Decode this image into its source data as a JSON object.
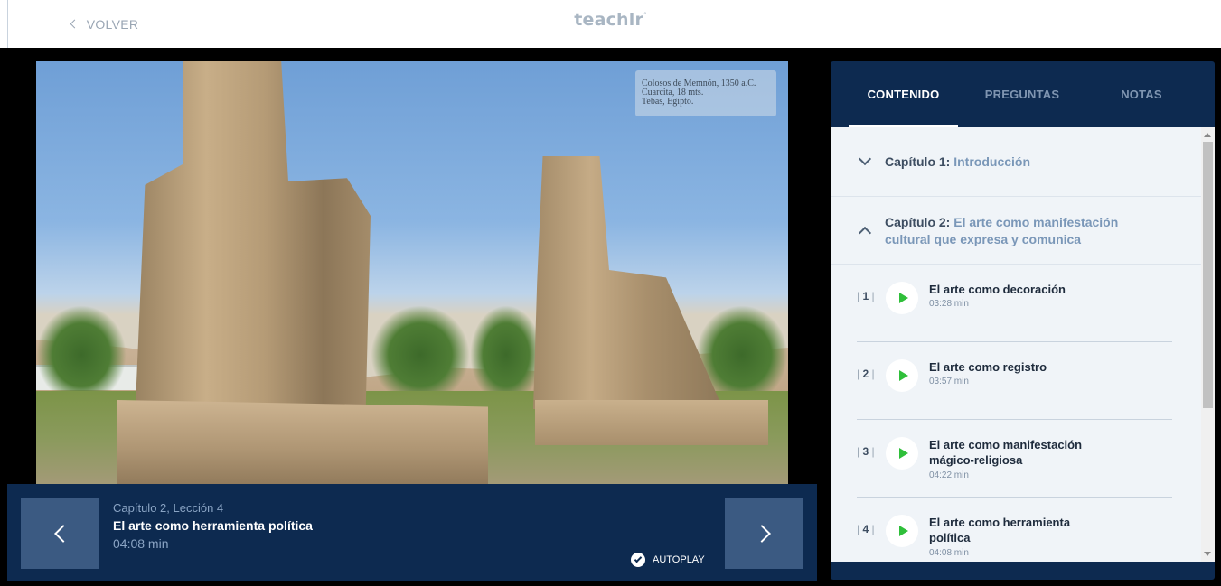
{
  "header": {
    "back_label": "VOLVER",
    "logo": "teachlr",
    "logo_mark": "°"
  },
  "video": {
    "caption": [
      "Colosos de Memnón, 1350 a.C.",
      "Cuarcita, 18 mts.",
      "Tebas, Egipto."
    ]
  },
  "current_lesson": {
    "chapter_label": "Capítulo 2, Lección 4",
    "title": "El arte como herramienta política",
    "duration": "04:08 min",
    "autoplay_label": "AUTOPLAY",
    "autoplay": true
  },
  "sidebar": {
    "tabs": [
      {
        "label": "CONTENIDO",
        "active": true
      },
      {
        "label": "PREGUNTAS",
        "active": false
      },
      {
        "label": "NOTAS",
        "active": false
      }
    ],
    "chapters": [
      {
        "prefix": "Capítulo 1:",
        "name": "Introducción",
        "expanded": false
      },
      {
        "prefix": "Capítulo 2:",
        "name": "El arte como manifestación cultural que expresa y comunica",
        "expanded": true
      }
    ],
    "lessons": [
      {
        "index": "1",
        "title": "El arte como decoración",
        "duration": "03:28 min"
      },
      {
        "index": "2",
        "title": "El arte como registro",
        "duration": "03:57 min"
      },
      {
        "index": "3",
        "title": "El arte como manifestación mágico-religiosa",
        "duration": "04:22 min"
      },
      {
        "index": "4",
        "title": "El arte como herramienta política",
        "duration": "04:08 min"
      }
    ]
  },
  "colors": {
    "navy": "#0d2a50",
    "nav_button": "#3b5a82",
    "play_green": "#2fbf3a",
    "panel_bg": "#f0f4f8"
  }
}
